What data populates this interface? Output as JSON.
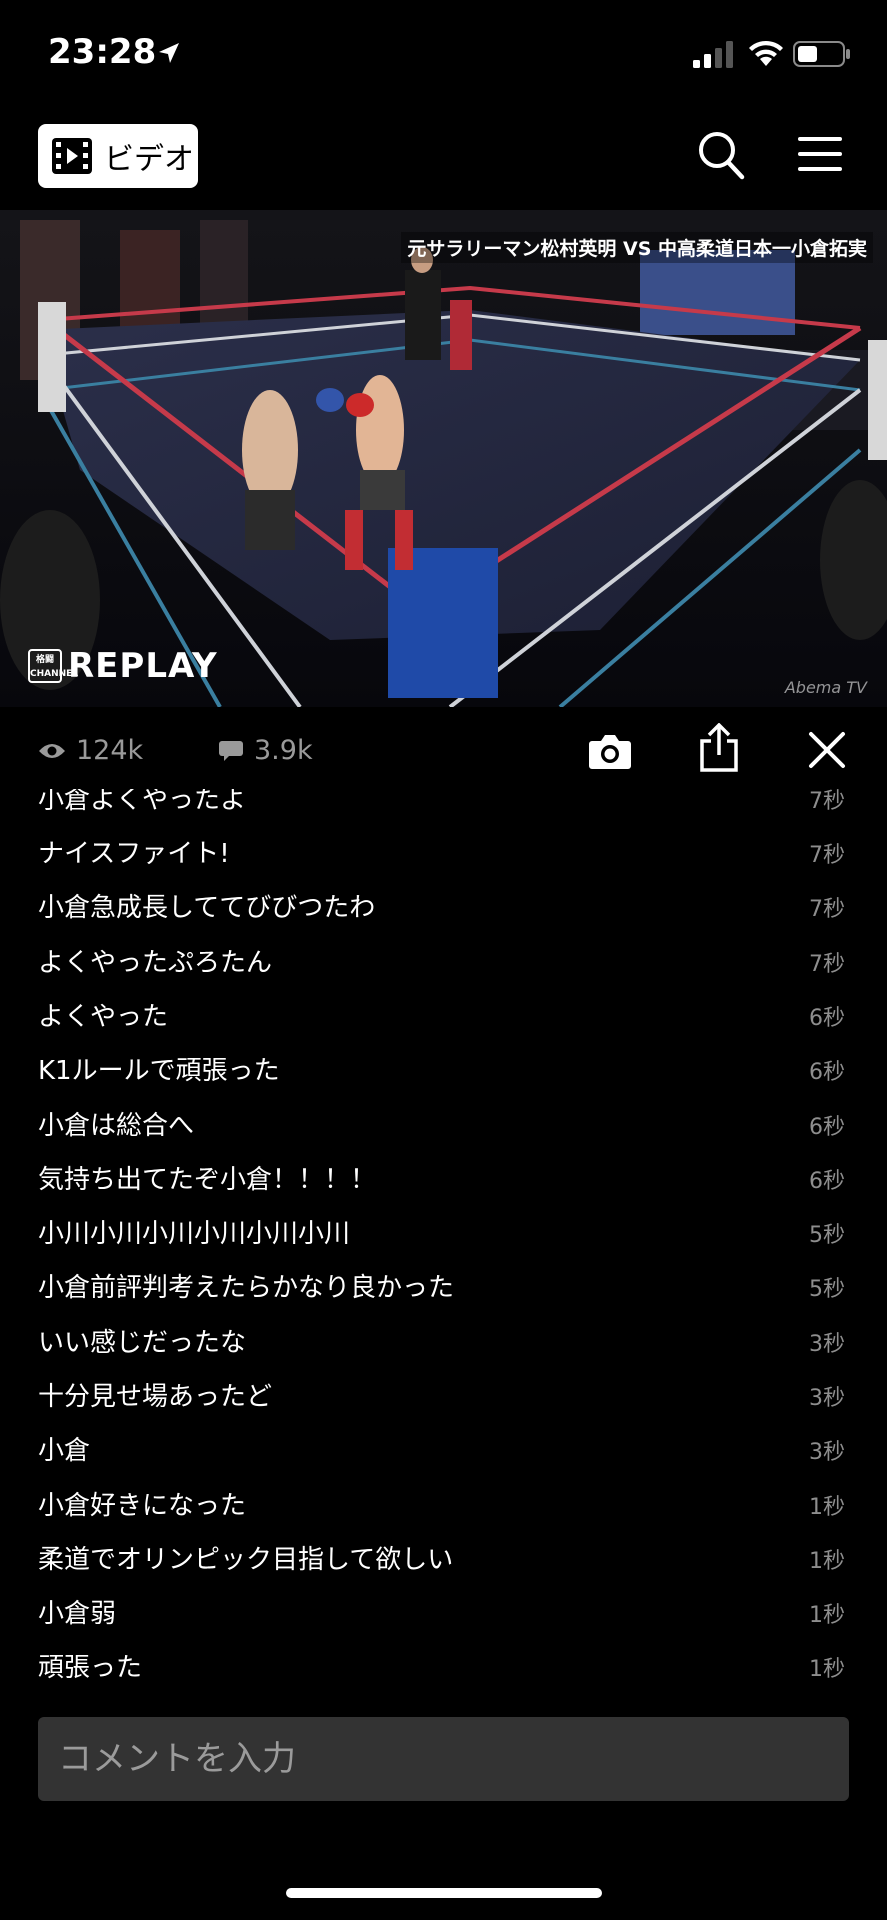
{
  "status_bar": {
    "time": "23:28",
    "signal_bars_filled": 2,
    "battery_level_fraction": 0.45
  },
  "header": {
    "brand_label": "ビデオ",
    "icons": [
      "film-icon",
      "search-icon",
      "menu-icon"
    ]
  },
  "video": {
    "caption": "元サラリーマン松村英明 VS 中高柔道日本一小倉拓実",
    "replay_logo": "格闘 CHANNEL",
    "replay_label": "REPLAY",
    "watermark": "Abema TV"
  },
  "stats": {
    "views": "124k",
    "comments": "3.9k",
    "icons": [
      "eye-icon",
      "comment-bubble-icon",
      "camera-icon",
      "share-icon",
      "close-icon"
    ]
  },
  "comments": [
    {
      "text": "小倉よくやったよ",
      "time": "7秒"
    },
    {
      "text": "ナイスファイト!",
      "time": "7秒"
    },
    {
      "text": "小倉急成長しててびびつたわ",
      "time": "7秒"
    },
    {
      "text": "よくやったぷろたん",
      "time": "7秒"
    },
    {
      "text": "よくやった",
      "time": "6秒"
    },
    {
      "text": "K1ルールで頑張った",
      "time": "6秒"
    },
    {
      "text": "小倉は総合へ",
      "time": "6秒"
    },
    {
      "text": "気持ち出てたぞ小倉！！！！",
      "time": "6秒"
    },
    {
      "text": "小川小川小川小川小川小川",
      "time": "5秒"
    },
    {
      "text": "小倉前評判考えたらかなり良かった",
      "time": "5秒"
    },
    {
      "text": "いい感じだったな",
      "time": "3秒"
    },
    {
      "text": "十分見せ場あったど",
      "time": "3秒"
    },
    {
      "text": "小倉",
      "time": "3秒"
    },
    {
      "text": "小倉好きになった",
      "time": "1秒"
    },
    {
      "text": "柔道でオリンピック目指して欲しい",
      "time": "1秒"
    },
    {
      "text": "小倉弱",
      "time": "1秒"
    },
    {
      "text": "頑張った",
      "time": "1秒"
    }
  ],
  "input": {
    "placeholder": "コメントを入力"
  }
}
